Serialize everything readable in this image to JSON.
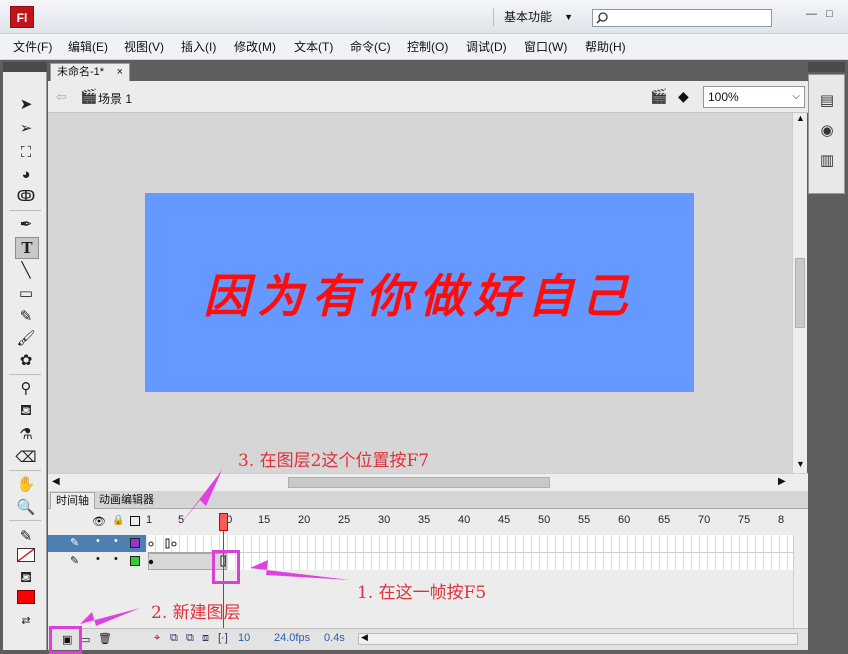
{
  "app": {
    "logo": "Fl",
    "workspace": "基本功能",
    "search_placeholder": "",
    "window_controls": [
      "—",
      "□"
    ]
  },
  "menu": [
    "文件(F)",
    "编辑(E)",
    "视图(V)",
    "插入(I)",
    "修改(M)",
    "文本(T)",
    "命令(C)",
    "控制(O)",
    "调试(D)",
    "窗口(W)",
    "帮助(H)"
  ],
  "document": {
    "tab_label": "未命名-1*",
    "tab_close": "×",
    "scene_label": "场景 1",
    "zoom": "100%"
  },
  "stage": {
    "text": "因为有你做好自己",
    "artboard_color": "#6699ff",
    "text_color": "#ff0d0d"
  },
  "timeline": {
    "tabs": [
      "时间轴",
      "动画编辑器"
    ],
    "ruler": [
      "1",
      "5",
      "10",
      "15",
      "20",
      "25",
      "30",
      "35",
      "40",
      "45",
      "50",
      "55",
      "60",
      "65",
      "70",
      "75",
      "8"
    ],
    "layers": [
      {
        "selected": true
      },
      {
        "selected": false
      }
    ],
    "current_frame": "10",
    "fps": "24.0fps",
    "time": "0.4s",
    "layer_colors": [
      "#9933cc",
      "#33cc33"
    ]
  },
  "annotations": {
    "step1": "1. 在这一帧按F5",
    "step2": "2. 新建图层",
    "step3": "3. 在图层2这个位置按F7"
  },
  "tools": [
    "selection-arrow",
    "subselection",
    "free-transform",
    "3d-rotation",
    "lasso",
    "pen",
    "text",
    "line",
    "rectangle",
    "pencil",
    "brush",
    "deco",
    "bone",
    "paint-bucket",
    "eyedropper",
    "eraser",
    "hand",
    "zoom",
    "stroke-color",
    "fill-color"
  ]
}
